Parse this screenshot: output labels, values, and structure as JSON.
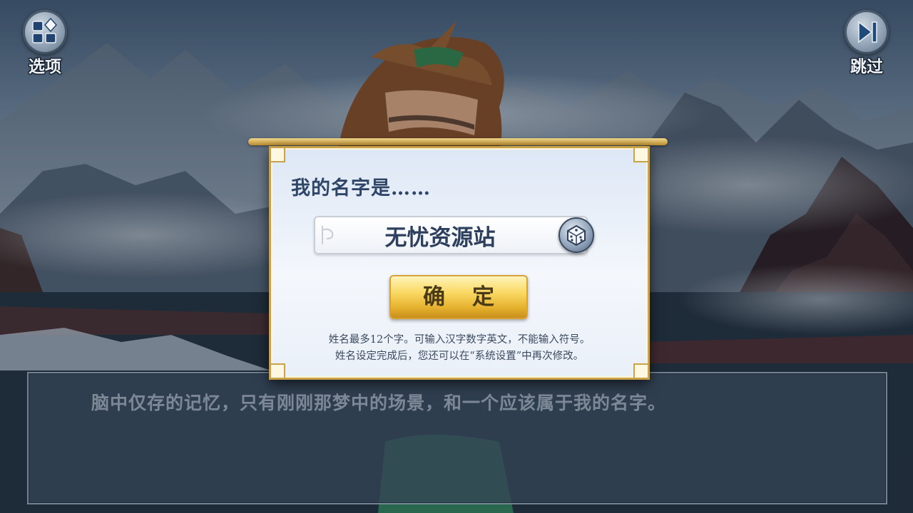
{
  "top_bar": {
    "options_label": "选项",
    "skip_label": "跳过"
  },
  "name_dialog": {
    "title": "我的名字是……",
    "name_value": "无忧资源站",
    "confirm_label": "确定",
    "hint_line_1": "姓名最多12个字。可输入汉字数字英文，不能输入符号。",
    "hint_line_2": "姓名设定完成后，您还可以在“系统设置”中再次修改。"
  },
  "dialogue_box": {
    "text": "脑中仅存的记忆，只有刚刚那梦中的场景，和一个应该属于我的名字。"
  },
  "colors": {
    "frame_gold": "#c9a24a",
    "title_blue": "#2f4668",
    "button_gold": "#f9d862"
  },
  "icons": {
    "options": "grid-diamond-icon",
    "skip": "skip-forward-icon",
    "random": "dice-icon"
  }
}
